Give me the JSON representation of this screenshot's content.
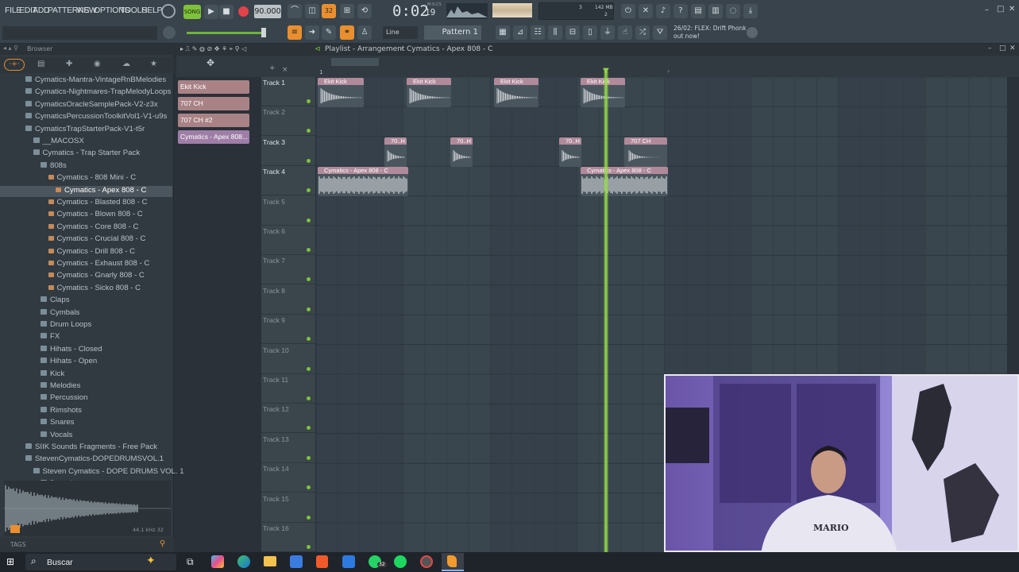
{
  "menu": [
    "FILE",
    "EDIT",
    "ADD",
    "PATTERNS",
    "VIEW",
    "OPTIONS",
    "TOOLS",
    "HELP"
  ],
  "transport": {
    "tempo": "90.000",
    "time": "0:02",
    "time_frac": "19",
    "time_label": "M:S:CS",
    "pattern": "Pattern 1",
    "snap": "Line",
    "cpu": "3",
    "mem": "142 MB",
    "poly": "2"
  },
  "hint": {
    "line1": "26/02: FLEX: Drift Phonk",
    "line2": "out now!"
  },
  "playlist": {
    "title": "Playlist - Arrangement",
    "sep": "›",
    "pattern": "Cymatics - Apex 808 - C"
  },
  "browser": {
    "title": "Browser",
    "items": [
      {
        "label": "Cymatics-Mantra-VintageRnBMelodies",
        "indent": 0,
        "kind": "folder"
      },
      {
        "label": "Cymatics-Nightmares-TrapMelodyLoops",
        "indent": 0,
        "kind": "folder"
      },
      {
        "label": "CymaticsOracleSamplePack-V2-z3x",
        "indent": 0,
        "kind": "folder"
      },
      {
        "label": "CymaticsPercussionToolkitVol1-V1-u9s",
        "indent": 0,
        "kind": "folder"
      },
      {
        "label": "CymaticsTrapStarterPack-V1-t5r",
        "indent": 0,
        "kind": "folder"
      },
      {
        "label": "__MACOSX",
        "indent": 1,
        "kind": "folder"
      },
      {
        "label": "Cymatics - Trap Starter Pack",
        "indent": 1,
        "kind": "folder"
      },
      {
        "label": "808s",
        "indent": 2,
        "kind": "folder"
      },
      {
        "label": "Cymatics - 808 Mini - C",
        "indent": 3,
        "kind": "sample"
      },
      {
        "label": "Cymatics - Apex 808 - C",
        "indent": 4,
        "kind": "sample",
        "selected": true
      },
      {
        "label": "Cymatics - Blasted 808 - C",
        "indent": 3,
        "kind": "sample"
      },
      {
        "label": "Cymatics - Blown 808 - C",
        "indent": 3,
        "kind": "sample"
      },
      {
        "label": "Cymatics - Core 808 - C",
        "indent": 3,
        "kind": "sample"
      },
      {
        "label": "Cymatics - Crucial 808 - C",
        "indent": 3,
        "kind": "sample"
      },
      {
        "label": "Cymatics - Drill 808 - C",
        "indent": 3,
        "kind": "sample"
      },
      {
        "label": "Cymatics - Exhaust 808 - C",
        "indent": 3,
        "kind": "sample"
      },
      {
        "label": "Cymatics - Gnarly 808 - C",
        "indent": 3,
        "kind": "sample"
      },
      {
        "label": "Cymatics - Sicko 808 - C",
        "indent": 3,
        "kind": "sample"
      },
      {
        "label": "Claps",
        "indent": 2,
        "kind": "folder"
      },
      {
        "label": "Cymbals",
        "indent": 2,
        "kind": "folder"
      },
      {
        "label": "Drum Loops",
        "indent": 2,
        "kind": "folder"
      },
      {
        "label": "FX",
        "indent": 2,
        "kind": "folder"
      },
      {
        "label": "Hihats - Closed",
        "indent": 2,
        "kind": "folder"
      },
      {
        "label": "Hihats - Open",
        "indent": 2,
        "kind": "folder"
      },
      {
        "label": "Kick",
        "indent": 2,
        "kind": "folder"
      },
      {
        "label": "Melodies",
        "indent": 2,
        "kind": "folder"
      },
      {
        "label": "Percussion",
        "indent": 2,
        "kind": "folder"
      },
      {
        "label": "Rimshots",
        "indent": 2,
        "kind": "folder"
      },
      {
        "label": "Snares",
        "indent": 2,
        "kind": "folder"
      },
      {
        "label": "Vocals",
        "indent": 2,
        "kind": "folder"
      },
      {
        "label": "SIIK Sounds Fragments - Free Pack",
        "indent": 0,
        "kind": "folder"
      },
      {
        "label": "StevenCymatics-DOPEDRUMSVOL.1",
        "indent": 0,
        "kind": "folder"
      },
      {
        "label": "Steven Cymatics - DOPE DRUMS VOL. 1",
        "indent": 1,
        "kind": "folder"
      },
      {
        "label": "Drum Loops",
        "indent": 2,
        "kind": "folder"
      }
    ],
    "sample_info": "44.1 kHz 32",
    "tags": "TAGS"
  },
  "channels": [
    "Ekit Kick",
    "707 CH",
    "707 CH #2",
    "Cymatics - Apex 808..."
  ],
  "tracks": [
    "Track 1",
    "Track 2",
    "Track 3",
    "Track 4",
    "Track 5",
    "Track 6",
    "Track 7",
    "Track 8",
    "Track 9",
    "Track 10",
    "Track 11",
    "Track 12",
    "Track 13",
    "Track 14",
    "Track 15",
    "Track 16"
  ],
  "clips": [
    {
      "label": "Ekit Kick",
      "track": 0
    },
    {
      "label": "Ekit Kick",
      "track": 0
    },
    {
      "label": "Ekit Kick",
      "track": 0
    },
    {
      "label": "Ekit Kick",
      "track": 0
    },
    {
      "label": "70..H",
      "track": 2
    },
    {
      "label": "70..H",
      "track": 2
    },
    {
      "label": "70..H",
      "track": 2
    },
    {
      "label": "707 CH",
      "track": 2
    },
    {
      "label": "Cymatics - Apex 808 - C",
      "track": 3
    },
    {
      "label": "Cymatics - Apex 808 - C",
      "track": 3
    }
  ],
  "ruler": {
    "bar1": "1"
  },
  "taskbar": {
    "search": "Buscar",
    "badge": "32"
  },
  "webcam": {
    "shirt": "MARIO"
  }
}
